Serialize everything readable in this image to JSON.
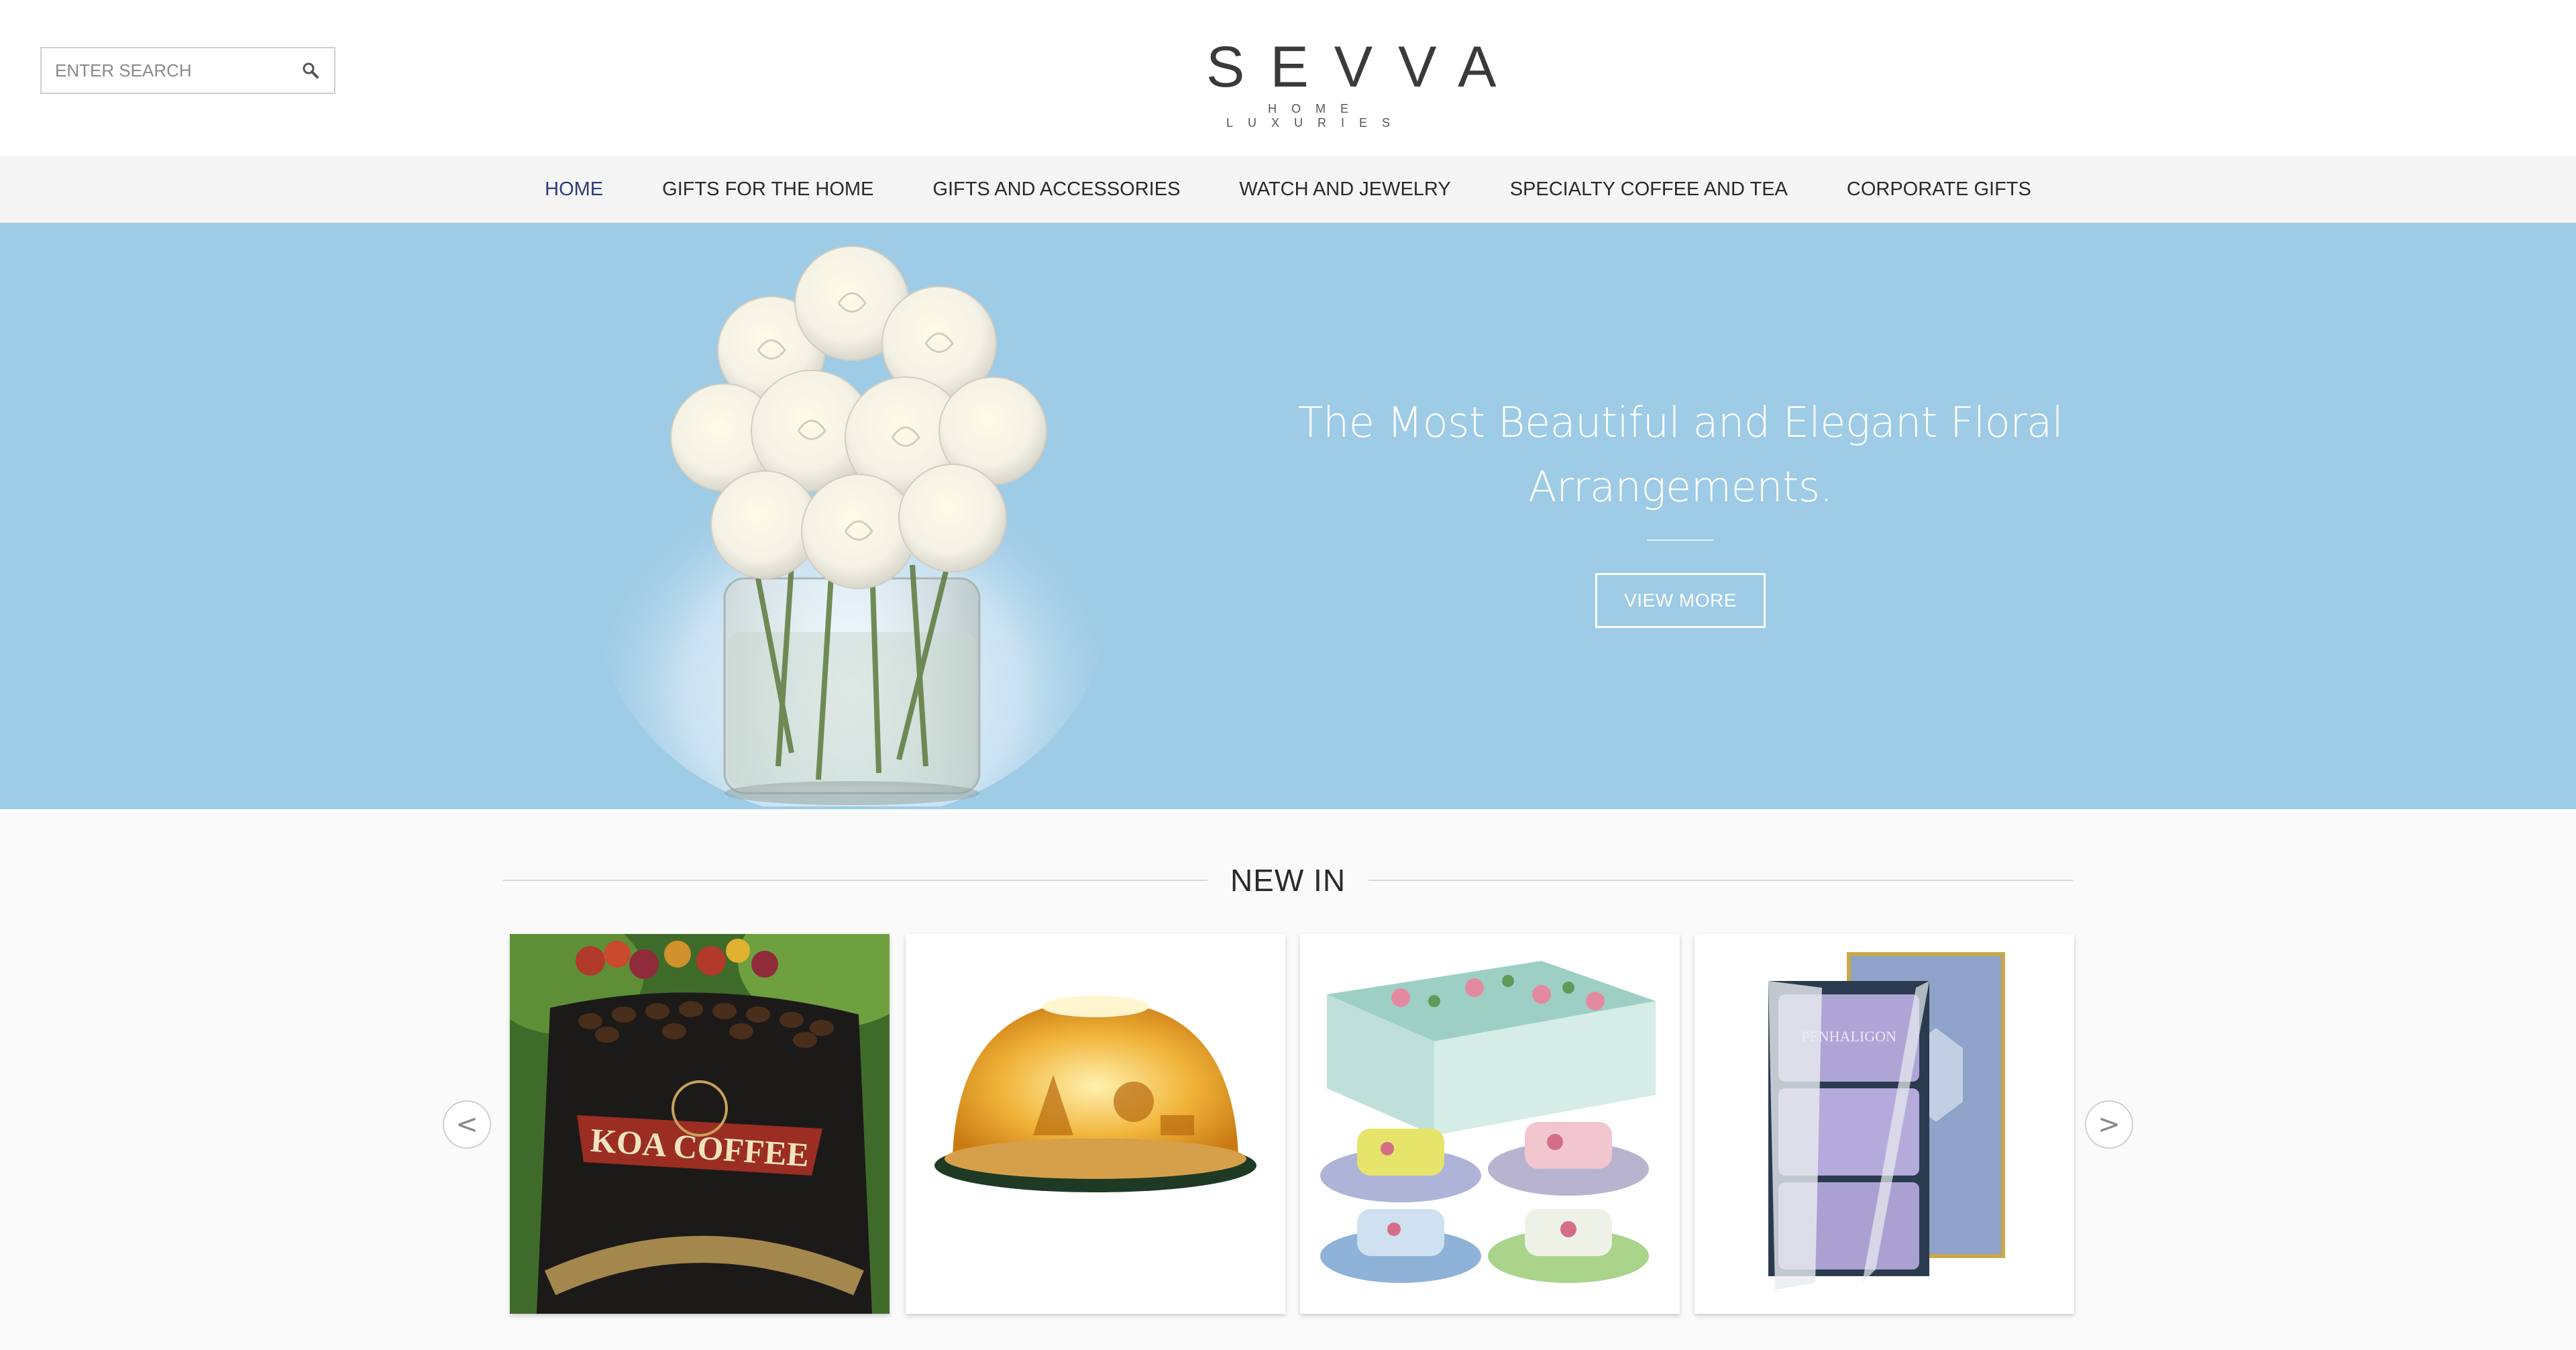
{
  "search": {
    "placeholder": "ENTER SEARCH",
    "icon": "search-icon"
  },
  "logo": {
    "name": "SEVVA",
    "tagline": "HOME LUXURIES"
  },
  "nav": {
    "items": [
      {
        "label": "HOME",
        "active": true
      },
      {
        "label": "GIFTS FOR THE HOME",
        "active": false
      },
      {
        "label": "GIFTS AND ACCESSORIES",
        "active": false
      },
      {
        "label": "WATCH AND JEWELRY",
        "active": false
      },
      {
        "label": "SPECIALTY COFFEE AND TEA",
        "active": false
      },
      {
        "label": "CORPORATE GIFTS",
        "active": false
      }
    ]
  },
  "hero": {
    "headline": "The Most Beautiful and Elegant Floral Arrangements.",
    "button_label": "VIEW MORE",
    "background_color": "#9ecbe6"
  },
  "new_in": {
    "title": "NEW IN",
    "prev_label": "<",
    "next_label": ">",
    "products": [
      {
        "image_label": "KOA COFFEE"
      },
      {
        "image_label": ""
      },
      {
        "image_label": ""
      },
      {
        "image_label": "PENHALIGON"
      }
    ]
  },
  "colors": {
    "accent": "#2e3b7a",
    "hero": "#9ecbe6"
  }
}
